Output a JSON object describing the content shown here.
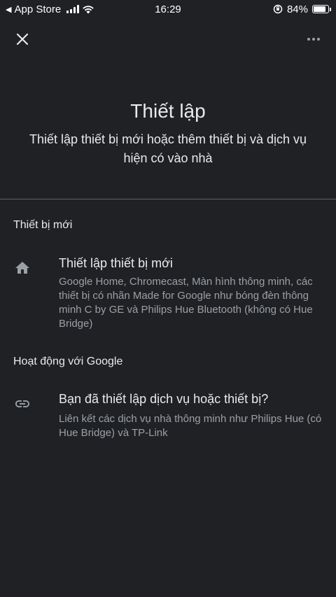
{
  "status_bar": {
    "back_app": "App Store",
    "time": "16:29",
    "battery_percent": "84%",
    "battery_level": 0.84
  },
  "app_bar": {
    "close_icon": "close-icon",
    "more_icon": "more-horizontal-icon"
  },
  "header": {
    "title": "Thiết lập",
    "subtitle": "Thiết lập thiết bị mới hoặc thêm thiết bị và dịch vụ hiện có vào nhà"
  },
  "sections": [
    {
      "heading": "Thiết bị mới",
      "item": {
        "icon": "home-icon",
        "title": "Thiết lập thiết bị mới",
        "description": "Google Home, Chromecast, Màn hình thông minh, các thiết bị có nhãn Made for Google như bóng đèn thông minh C by GE và Philips Hue Bluetooth (không có Hue Bridge)"
      }
    },
    {
      "heading": "Hoạt động với Google",
      "item": {
        "icon": "link-icon",
        "title": "Bạn đã thiết lập dịch vụ hoặc thiết bị?",
        "description": "Liên kết các dịch vụ nhà thông minh như Philips Hue (có Hue Bridge) và TP-Link"
      }
    }
  ],
  "colors": {
    "background": "#202124",
    "primary_text": "#e8eaed",
    "secondary_text": "#9aa0a6",
    "icon": "#9aa0a6",
    "divider": "#5f6368"
  }
}
